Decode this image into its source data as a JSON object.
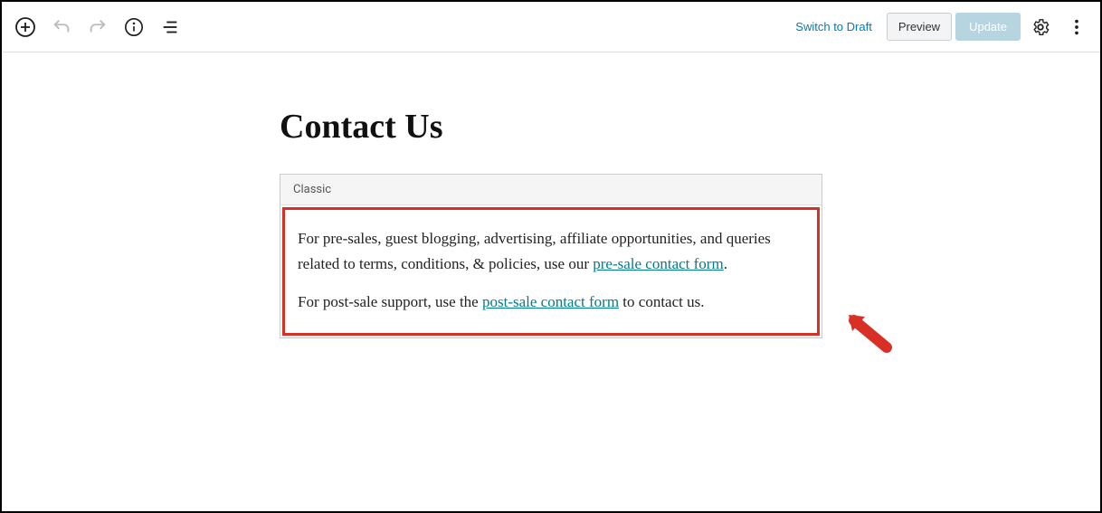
{
  "toolbar": {
    "switch_draft_label": "Switch to Draft",
    "preview_label": "Preview",
    "update_label": "Update"
  },
  "page": {
    "title": "Contact Us"
  },
  "block": {
    "type_label": "Classic",
    "para1_part1": "For pre-sales, guest blogging, advertising, affiliate opportunities, and queries related to terms, conditions, & policies, use our ",
    "para1_link": "pre-sale contact form",
    "para1_part2": ".",
    "para2_part1": "For post-sale support, use the ",
    "para2_link": "post-sale contact form",
    "para2_part2": " to contact us."
  }
}
